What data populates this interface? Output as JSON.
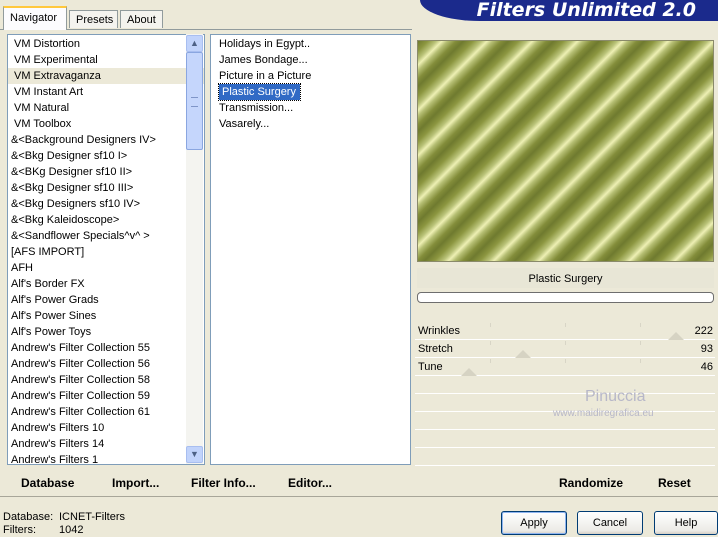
{
  "app": {
    "title": "Filters Unlimited 2.0"
  },
  "tabs": [
    {
      "label": "Navigator",
      "active": true
    },
    {
      "label": "Presets",
      "active": false
    },
    {
      "label": "About",
      "active": false
    }
  ],
  "categories": [
    "VM Distortion",
    "VM Experimental",
    "VM Extravaganza",
    "VM Instant Art",
    "VM Natural",
    "VM Toolbox",
    "&<Background Designers IV>",
    "&<Bkg Designer sf10 I>",
    "&<BKg Designer sf10 II>",
    "&<Bkg Designer sf10 III>",
    "&<Bkg Designers sf10 IV>",
    "&<Bkg Kaleidoscope>",
    "&<Sandflower Specials^v^ >",
    "[AFS IMPORT]",
    "AFH",
    "Alf's Border FX",
    "Alf's Power Grads",
    "Alf's Power Sines",
    "Alf's Power Toys",
    "Andrew's Filter Collection 55",
    "Andrew's Filter Collection 56",
    "Andrew's Filter Collection 58",
    "Andrew's Filter Collection 59",
    "Andrew's Filter Collection 61",
    "Andrew's Filters 10",
    "Andrew's Filters 14",
    "Andrew's Filters 1"
  ],
  "filters": [
    "Holidays in Egypt..",
    "James Bondage...",
    "Picture in a Picture",
    "Plastic Surgery",
    "Transmission...",
    "Vasarely..."
  ],
  "preview": {
    "filter_name": "Plastic Surgery"
  },
  "params": [
    {
      "name": "Wrinkles",
      "value": "222",
      "fraction": 0.87
    },
    {
      "name": "Stretch",
      "value": "93",
      "fraction": 0.36
    },
    {
      "name": "Tune",
      "value": "46",
      "fraction": 0.18
    }
  ],
  "watermark": {
    "line1": "Pinuccia",
    "line2": "www.maidiregrafica.eu"
  },
  "toolbar": {
    "database": "Database",
    "import": "Import...",
    "filter_info": "Filter Info...",
    "editor": "Editor...",
    "randomize": "Randomize",
    "reset": "Reset"
  },
  "status": {
    "database_label": "Database:",
    "database_value": "ICNET-Filters",
    "filters_label": "Filters:",
    "filters_value": "1042"
  },
  "buttons": {
    "apply": "Apply",
    "cancel": "Cancel",
    "help": "Help"
  },
  "colors": {
    "banner": "#1b2a8c",
    "selection": "#316ac5"
  }
}
